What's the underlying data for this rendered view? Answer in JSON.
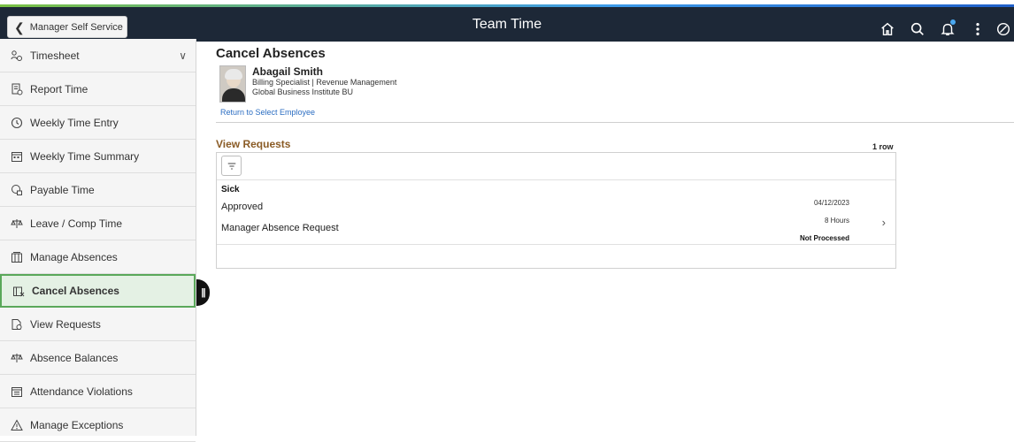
{
  "header": {
    "back_label": "Manager Self Service",
    "title": "Team Time",
    "icons": [
      "home-icon",
      "search-icon",
      "notifications-icon",
      "actions-menu-icon",
      "navbar-icon"
    ],
    "colors": {
      "bar": "#1d2837",
      "accent_gradient": [
        "#7ac143",
        "#3d9be9",
        "#1f5fc9"
      ]
    }
  },
  "sidebar": {
    "items": [
      {
        "label": "Timesheet",
        "icon": "timesheet-icon",
        "expandable": true
      },
      {
        "label": "Report Time",
        "icon": "report-time-icon"
      },
      {
        "label": "Weekly Time Entry",
        "icon": "clock-icon"
      },
      {
        "label": "Weekly Time Summary",
        "icon": "calendar-summary-icon"
      },
      {
        "label": "Payable Time",
        "icon": "payable-time-icon"
      },
      {
        "label": "Leave / Comp Time",
        "icon": "scales-icon"
      },
      {
        "label": "Manage Absences",
        "icon": "manage-absences-icon"
      },
      {
        "label": "Cancel Absences",
        "icon": "cancel-absences-icon",
        "selected": true
      },
      {
        "label": "View Requests",
        "icon": "view-requests-icon"
      },
      {
        "label": "Absence Balances",
        "icon": "scales-icon"
      },
      {
        "label": "Attendance Violations",
        "icon": "calendar-icon"
      },
      {
        "label": "Manage Exceptions",
        "icon": "warning-icon"
      }
    ],
    "selected_color": "#5aa85a"
  },
  "main": {
    "title": "Cancel Absences",
    "employee": {
      "name": "Abagail Smith",
      "job": "Billing Specialist | Revenue Management",
      "business_unit": "Global Business Institute BU"
    },
    "return_link": "Return to Select Employee",
    "section_title": "View Requests",
    "row_count": "1 row",
    "rows": [
      {
        "type": "Sick",
        "status": "Approved",
        "source": "Manager Absence Request",
        "date": "04/12/2023",
        "duration": "8 Hours",
        "processing": "Not Processed"
      }
    ]
  }
}
